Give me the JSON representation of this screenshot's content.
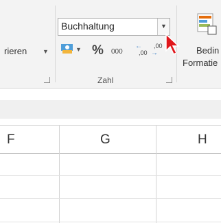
{
  "ribbon": {
    "left_label": "rieren",
    "number_format": "Buchhaltung",
    "percent_label": "%",
    "thousands_label": "000",
    "decimal_increase_label": ",00",
    "decimal_decrease_label": ",00",
    "group_label": "Zahl",
    "right_top": "Bedin",
    "right_bottom": "Formatie"
  },
  "grid": {
    "columns": [
      "F",
      "G",
      "H"
    ]
  }
}
